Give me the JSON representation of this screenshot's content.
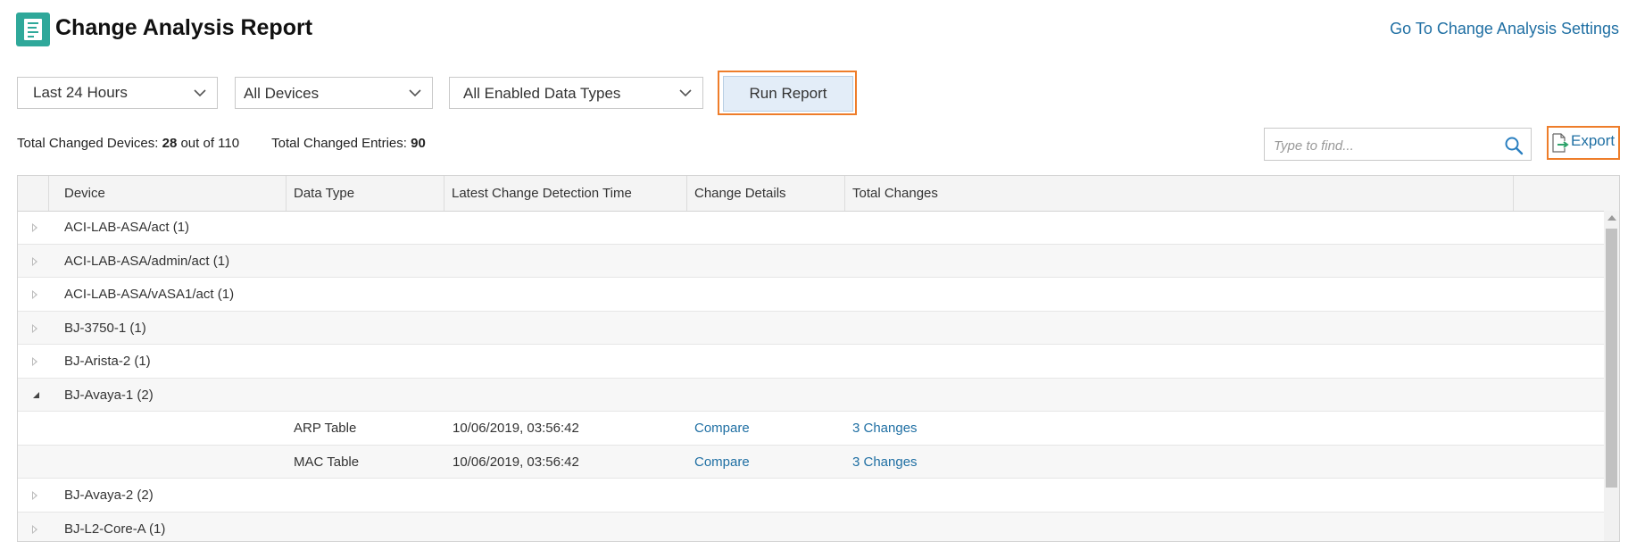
{
  "header": {
    "title": "Change Analysis Report",
    "icon": "report-icon",
    "settings_link": "Go To Change Analysis Settings"
  },
  "filters": {
    "time_range": "Last 24 Hours",
    "devices": "All Devices",
    "data_types": "All Enabled Data Types",
    "run_label": "Run Report"
  },
  "summary": {
    "devices_label": "Total Changed Devices:",
    "devices_changed": "28",
    "devices_out_of": "out of 110",
    "entries_label": "Total Changed Entries:",
    "entries_changed": "90"
  },
  "search": {
    "placeholder": "Type to find..."
  },
  "export": {
    "label": "Export"
  },
  "colors": {
    "accent": "#2fa89a",
    "link": "#1f6fa3",
    "highlight": "#ee7d2a",
    "button_bg": "#e3edf8"
  },
  "table": {
    "columns": [
      "Device",
      "Data Type",
      "Latest Change Detection Time",
      "Change Details",
      "Total Changes"
    ],
    "rows": [
      {
        "device": "ACI-LAB-ASA/act (1)",
        "expanded": false
      },
      {
        "device": "ACI-LAB-ASA/admin/act (1)",
        "expanded": false
      },
      {
        "device": "ACI-LAB-ASA/vASA1/act (1)",
        "expanded": false
      },
      {
        "device": "BJ-3750-1 (1)",
        "expanded": false
      },
      {
        "device": "BJ-Arista-2 (1)",
        "expanded": false
      },
      {
        "device": "BJ-Avaya-1 (2)",
        "expanded": true
      },
      {
        "data_type": "ARP Table",
        "time": "10/06/2019, 03:56:42",
        "details": "Compare",
        "total": "3 Changes"
      },
      {
        "data_type": "MAC Table",
        "time": "10/06/2019, 03:56:42",
        "details": "Compare",
        "total": "3 Changes"
      },
      {
        "device": "BJ-Avaya-2 (2)",
        "expanded": false
      },
      {
        "device": "BJ-L2-Core-A (1)",
        "expanded": false
      }
    ]
  }
}
